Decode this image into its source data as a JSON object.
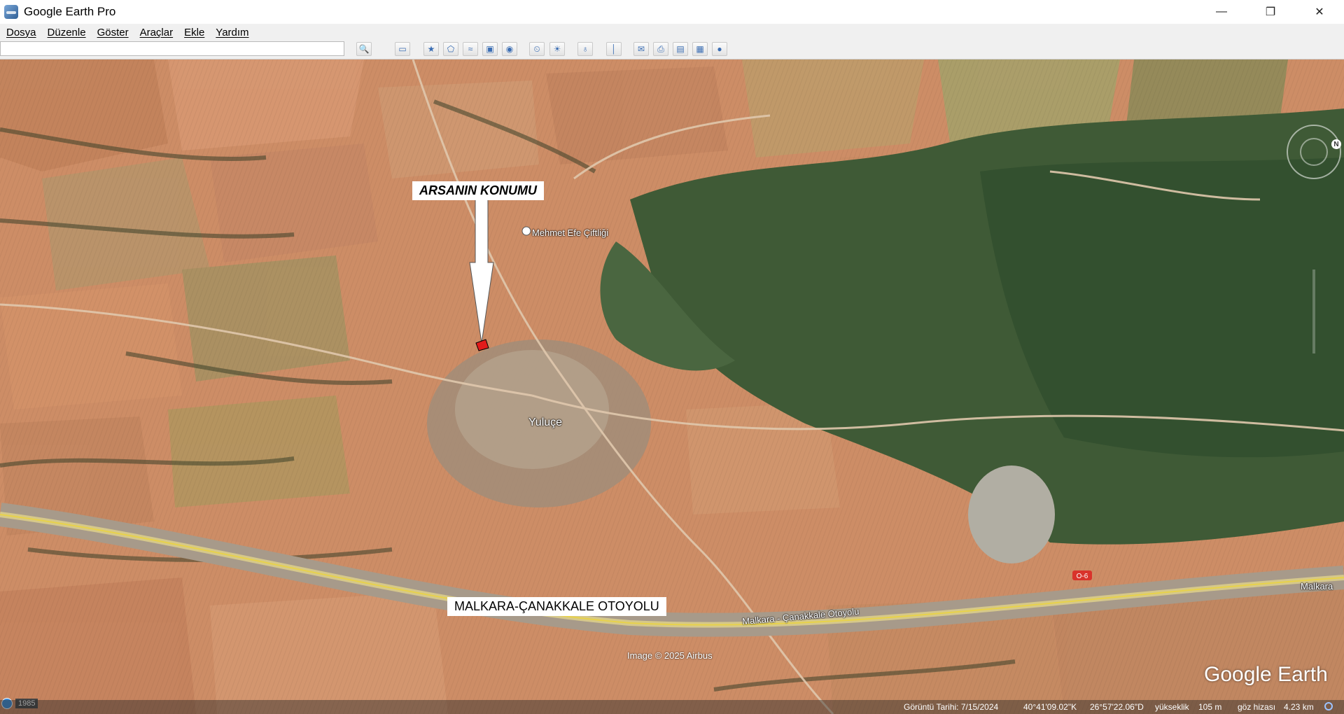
{
  "window": {
    "title": "Google Earth Pro",
    "controls": {
      "minimize": "—",
      "restore": "❐",
      "close": "✕"
    }
  },
  "menu": [
    "Dosya",
    "Düzenle",
    "Göster",
    "Araçlar",
    "Ekle",
    "Yardım"
  ],
  "toolbar": {
    "search_value": "",
    "buttons": [
      {
        "name": "search-icon",
        "glyph": "🔍"
      },
      {
        "name": "sidebar-toggle-icon",
        "glyph": "▭"
      },
      {
        "name": "add-placemark-icon",
        "glyph": "★"
      },
      {
        "name": "add-polygon-icon",
        "glyph": "⬠"
      },
      {
        "name": "add-path-icon",
        "glyph": "≈"
      },
      {
        "name": "add-image-overlay-icon",
        "glyph": "▣"
      },
      {
        "name": "record-tour-icon",
        "glyph": "◉"
      },
      {
        "name": "historical-imagery-icon",
        "glyph": "⏲"
      },
      {
        "name": "sunlight-icon",
        "glyph": "☀"
      },
      {
        "name": "planets-icon",
        "glyph": "♁"
      },
      {
        "name": "ruler-icon",
        "glyph": "│"
      },
      {
        "name": "email-icon",
        "glyph": "✉"
      },
      {
        "name": "print-icon",
        "glyph": "⎙"
      },
      {
        "name": "save-image-icon",
        "glyph": "▤"
      },
      {
        "name": "view-in-maps-icon",
        "glyph": "▦"
      },
      {
        "name": "earth-gallery-icon",
        "glyph": "●"
      }
    ]
  },
  "map": {
    "labels": {
      "plot_location": "ARSANIN KONUMU",
      "highway": "MALKARA-ÇANAKKALE OTOYOLU"
    },
    "places": {
      "farm": "Mehmet Efe Çiftliği",
      "village": "Yuluçe",
      "road": "Malkara - Çanakkale Otoyolu",
      "road_right": "Malkara",
      "road_badge": "O-6"
    },
    "copyright": "Image © 2025 Airbus",
    "logo": "Google Earth",
    "imagery_year": "1985",
    "compass_n": "N"
  },
  "status": {
    "imagery_date": "Görüntü Tarihi: 7/15/2024",
    "lat": "40°41'09.02\"K",
    "lon": "26°57'22.06\"D",
    "elevation_label": "yükseklik",
    "elevation": "105 m",
    "eye_label": "göz hizası",
    "eye_alt": "4.23 km"
  }
}
